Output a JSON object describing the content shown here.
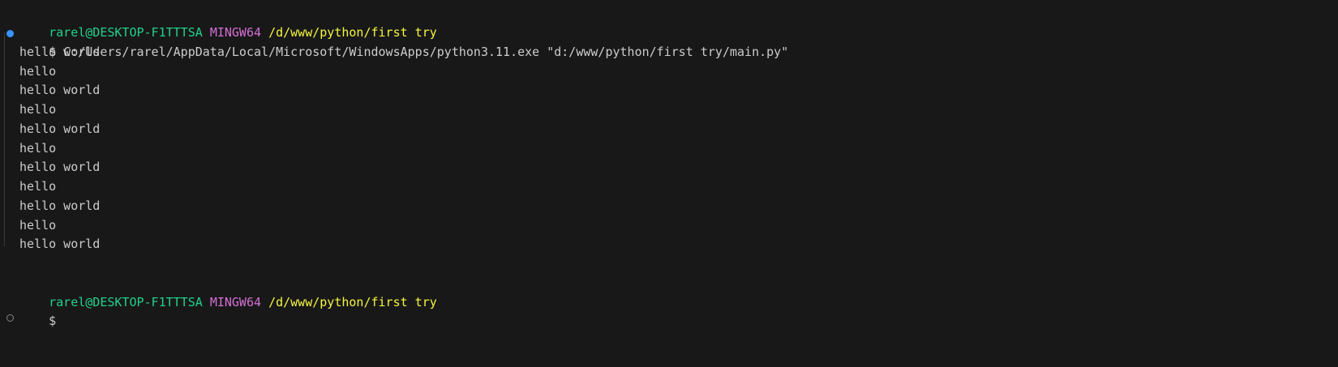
{
  "prompt1": {
    "user": "rarel@DESKTOP-F1TTTSA",
    "env": "MINGW64",
    "path": "/d/www/python/first try"
  },
  "command": {
    "symbol": "$",
    "text": "C:/Users/rarel/AppData/Local/Microsoft/WindowsApps/python3.11.exe \"d:/www/python/first try/main.py\""
  },
  "output": [
    "hello world",
    "hello",
    "hello world",
    "hello",
    "hello world",
    "hello",
    "hello world",
    "hello",
    "hello world",
    "hello",
    "hello world"
  ],
  "prompt2": {
    "user": "rarel@DESKTOP-F1TTTSA",
    "env": "MINGW64",
    "path": "/d/www/python/first try",
    "symbol": "$"
  },
  "icons": {
    "command_success": "filled-circle-icon",
    "command_pending": "empty-circle-icon"
  },
  "colors": {
    "background": "#181818",
    "user": "#23d18b",
    "env": "#d670d6",
    "path": "#f5f543",
    "text": "#cccccc",
    "decoration_success": "#3794ff",
    "decoration_pending": "#858585"
  }
}
